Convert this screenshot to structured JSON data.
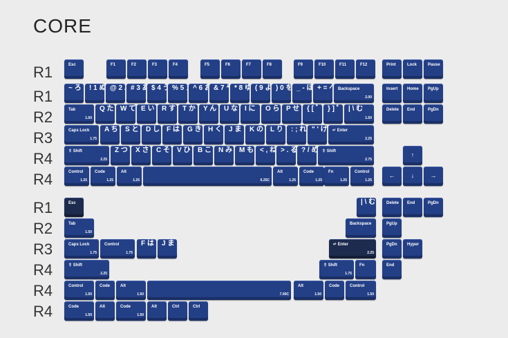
{
  "title": "CORE",
  "row_labels": [
    "R1",
    "R1",
    "R2",
    "R3",
    "R4",
    "R4",
    "R1",
    "R2",
    "R3",
    "R4",
    "R4",
    "R4"
  ],
  "colors": {
    "keycap": "#233f86",
    "keycap_dark": "#1d2b4e",
    "background": "#ececec"
  },
  "keys": {
    "esc": "Esc",
    "f1": "F1",
    "f2": "F2",
    "f3": "F3",
    "f4": "F4",
    "f5": "F5",
    "f6": "F6",
    "f7": "F7",
    "f8": "F8",
    "f9": "F9",
    "f10": "F10",
    "f11": "F11",
    "f12": "F12",
    "print": "Print",
    "lock": "Lock",
    "pause": "Pause",
    "backspace": "Backspace",
    "backspace_size": "2.00",
    "insert": "Insert",
    "home": "Home",
    "pgup": "PgUp",
    "tab": "Tab",
    "tab_size": "1.50",
    "delete": "Delete",
    "end": "End",
    "pgdn": "PgDn",
    "caps": "Caps Lock",
    "caps_size": "1.75",
    "enter": "Enter",
    "enter_size": "2.25",
    "shift": "Shift",
    "lshift_size": "2.25",
    "rshift_size": "2.75",
    "control": "Control",
    "code": "Code",
    "alt": "Alt",
    "fn": "Fn",
    "size_125": "1.25",
    "space_size": "6.25C",
    "hyper": "Hyper",
    "ctrl": "Ctrl",
    "space7_size": "7.00C",
    "size_150": "1.50",
    "size_175": "1.75",
    "caps2": "Caps Lock",
    "j_ha": "は",
    "j_ma": "ま",
    "f": "F",
    "j": "J",
    "tab2": "Tab"
  },
  "legends": {
    "num": [
      "~ ろ",
      "! 1 ぬ",
      "@ 2 ふ",
      "# 3 あ",
      "$ 4 う",
      "% 5 え",
      "^ 6 お",
      "& 7 や",
      "* 8 ゆ",
      "( 9 よ",
      ") 0 を",
      "_ - ほ",
      "+ = へ"
    ],
    "qrow": [
      "Q た",
      "W て",
      "E い",
      "R す",
      "T か",
      "Y ん",
      "U な",
      "I に",
      "O ら",
      "P せ",
      "{ [ ゛",
      "} ] ゜",
      "| \\ む"
    ],
    "arow": [
      "A ち",
      "S と",
      "D し",
      "F は",
      "G き",
      "H く",
      "J ま",
      "K の",
      "L り",
      ": ; れ",
      "\" ' け"
    ],
    "zrow": [
      "Z つ",
      "X さ",
      "C そ",
      "V ひ",
      "B こ",
      "N み",
      "M も",
      "< , ね",
      "> . る",
      "? / め"
    ],
    "arrows": [
      "↑",
      "←",
      "↓",
      "→"
    ]
  }
}
